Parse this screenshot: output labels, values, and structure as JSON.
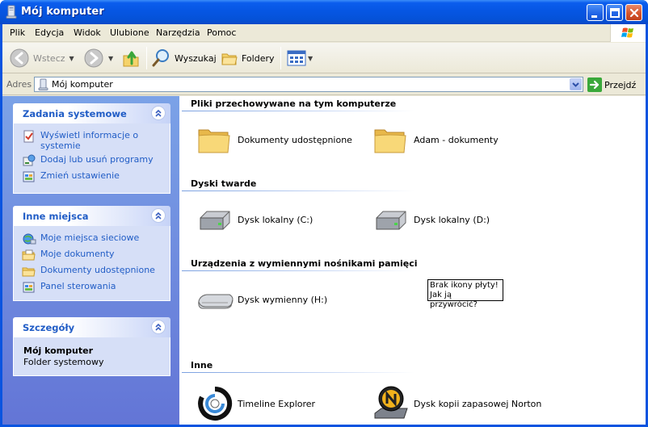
{
  "window": {
    "title": "Mój komputer"
  },
  "menu": {
    "items": [
      "Plik",
      "Edycja",
      "Widok",
      "Ulubione",
      "Narzędzia",
      "Pomoc"
    ]
  },
  "toolbar": {
    "back": "Wstecz",
    "search": "Wyszukaj",
    "folders": "Foldery"
  },
  "address": {
    "label": "Adres",
    "value": "Mój komputer",
    "go": "Przejdź"
  },
  "task_pane": {
    "system_tasks": {
      "title": "Zadania systemowe",
      "items": [
        "Wyświetl informacje o systemie",
        "Dodaj lub usuń programy",
        "Zmień ustawienie"
      ]
    },
    "other_places": {
      "title": "Inne miejsca",
      "items": [
        "Moje miejsca sieciowe",
        "Moje dokumenty",
        "Dokumenty udostępnione",
        "Panel sterowania"
      ]
    },
    "details": {
      "title": "Szczegóły",
      "name": "Mój komputer",
      "type": "Folder systemowy"
    }
  },
  "groups": {
    "stored": {
      "title": "Pliki przechowywane na tym komputerze",
      "items": [
        "Dokumenty udostępnione",
        "Adam - dokumenty"
      ]
    },
    "hard_drives": {
      "title": "Dyski twarde",
      "items": [
        "Dysk lokalny (C:)",
        "Dysk lokalny (D:)"
      ]
    },
    "removable": {
      "title": "Urządzenia z wymiennymi nośnikami pamięci",
      "items": [
        "Dysk wymienny (H:)"
      ]
    },
    "other": {
      "title": "Inne",
      "items": [
        "Timeline Explorer",
        "Dysk kopii zapasowej Norton"
      ]
    }
  },
  "annotation": {
    "line1": "Brak ikony płyty!",
    "line2": "Jak ją przywrócić?"
  },
  "colors": {
    "title_bar": "#0553db",
    "task_link": "#215dc6",
    "task_pane_bg": "#6f8fe0"
  }
}
